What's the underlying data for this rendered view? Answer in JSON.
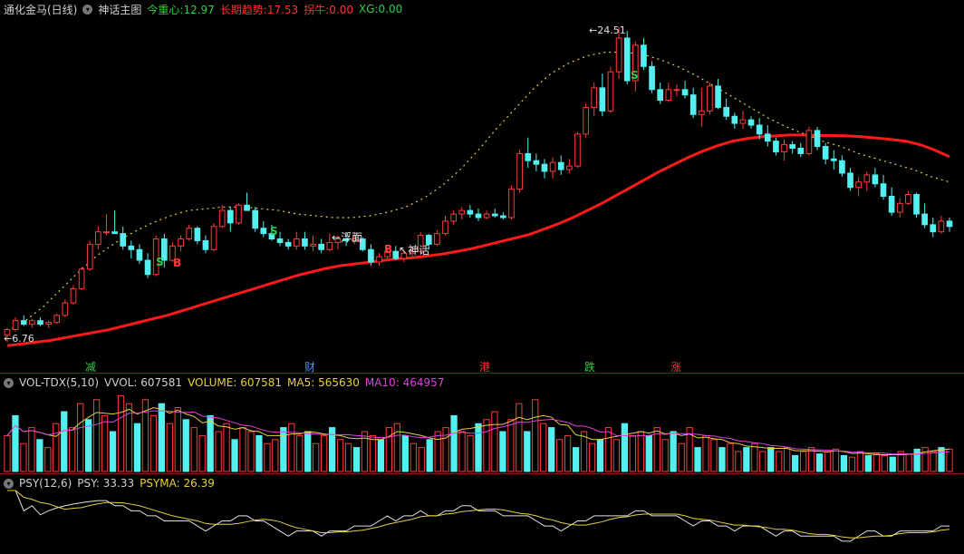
{
  "main": {
    "indicator_name": "通化金马(日线)",
    "formula_name": "神话主图",
    "legend": [
      {
        "label": "今重心:",
        "value": "12.97",
        "color": "#2ecc40"
      },
      {
        "label": "长期趋势:",
        "value": "17.53",
        "color": "#ff3030"
      },
      {
        "label": "拐牛:",
        "value": "0.00",
        "color": "#ff3030"
      },
      {
        "label": "XG:",
        "value": "0.00",
        "color": "#2ecc40"
      }
    ],
    "low_label": "6.76",
    "high_label": "24.51",
    "annotations": {
      "float_label": "浮面",
      "shenhua_label": "神话"
    },
    "signals": {
      "s1": "S",
      "b1": "B",
      "s2": "S",
      "b2": "B",
      "s3": "S"
    },
    "event_labels": [
      {
        "text": "减",
        "color": "#2ecc40"
      },
      {
        "text": "财",
        "color": "#4a90ff"
      },
      {
        "text": "港",
        "color": "#ff3030"
      },
      {
        "text": "跌",
        "color": "#2ecc40"
      },
      {
        "text": "涨",
        "color": "#ff3030"
      }
    ]
  },
  "volume": {
    "name": "VOL-TDX(5,10)",
    "legend": [
      {
        "label": "VVOL:",
        "value": "607581",
        "color": "#d0d0d0"
      },
      {
        "label": "VOLUME:",
        "value": "607581",
        "color": "#e8d040"
      },
      {
        "label": "MA5:",
        "value": "565630",
        "color": "#e8d040"
      },
      {
        "label": "MA10:",
        "value": "464957",
        "color": "#e040e0"
      }
    ]
  },
  "psy": {
    "name": "PSY(12,6)",
    "legend": [
      {
        "label": "PSY:",
        "value": "33.33",
        "color": "#d0d0d0"
      },
      {
        "label": "PSYMA:",
        "value": "26.39",
        "color": "#e8d040"
      }
    ]
  },
  "colors": {
    "up": "#ff3a3a",
    "down": "#54f0f0",
    "trend": "#ff1a1a",
    "dotted": "#e8d040",
    "ma10": "#e040e0"
  },
  "chart_data": {
    "type": "candlestick",
    "price_range": [
      6.76,
      24.51
    ],
    "candles": [
      [
        7.2,
        7.6,
        6.8,
        7.5
      ],
      [
        7.5,
        8.2,
        7.4,
        8.0
      ],
      [
        8.0,
        8.3,
        7.7,
        7.8
      ],
      [
        7.8,
        8.1,
        7.6,
        8.0
      ],
      [
        8.0,
        8.2,
        7.7,
        7.8
      ],
      [
        7.8,
        8.0,
        7.6,
        7.9
      ],
      [
        7.9,
        8.4,
        7.8,
        8.3
      ],
      [
        8.3,
        9.2,
        8.2,
        9.0
      ],
      [
        9.0,
        10.0,
        8.9,
        9.8
      ],
      [
        9.8,
        11.0,
        9.7,
        10.9
      ],
      [
        10.9,
        12.5,
        10.8,
        12.3
      ],
      [
        12.3,
        13.3,
        12.0,
        13.0
      ],
      [
        13.0,
        14.0,
        12.8,
        13.0
      ],
      [
        13.0,
        14.2,
        12.9,
        12.9
      ],
      [
        12.9,
        13.3,
        12.0,
        12.2
      ],
      [
        12.2,
        12.5,
        11.5,
        12.0
      ],
      [
        12.0,
        12.3,
        11.2,
        11.4
      ],
      [
        11.4,
        11.8,
        10.4,
        10.6
      ],
      [
        10.6,
        12.8,
        10.5,
        12.6
      ],
      [
        12.6,
        12.9,
        11.0,
        11.4
      ],
      [
        11.4,
        12.4,
        11.3,
        12.2
      ],
      [
        12.2,
        12.8,
        11.9,
        12.6
      ],
      [
        12.6,
        13.4,
        12.5,
        13.2
      ],
      [
        13.2,
        13.3,
        12.3,
        12.5
      ],
      [
        12.5,
        12.8,
        11.8,
        12.0
      ],
      [
        12.0,
        13.5,
        11.9,
        13.3
      ],
      [
        13.3,
        14.5,
        13.2,
        14.2
      ],
      [
        14.2,
        14.4,
        13.0,
        13.5
      ],
      [
        13.5,
        14.6,
        13.4,
        14.5
      ],
      [
        14.5,
        15.2,
        14.3,
        14.2
      ],
      [
        14.2,
        14.4,
        13.0,
        13.2
      ],
      [
        13.2,
        13.6,
        12.7,
        12.9
      ],
      [
        12.9,
        13.4,
        12.5,
        12.6
      ],
      [
        12.6,
        13.0,
        12.2,
        12.4
      ],
      [
        12.4,
        12.6,
        12.0,
        12.2
      ],
      [
        12.2,
        13.0,
        12.0,
        12.6
      ],
      [
        12.6,
        13.0,
        12.0,
        12.2
      ],
      [
        12.2,
        12.8,
        11.9,
        12.3
      ],
      [
        12.3,
        12.6,
        11.8,
        12.0
      ],
      [
        12.0,
        12.9,
        11.9,
        12.4
      ],
      [
        12.4,
        12.8,
        12.0,
        12.6
      ],
      [
        12.6,
        12.9,
        12.2,
        12.5
      ],
      [
        12.5,
        13.0,
        12.3,
        12.6
      ],
      [
        12.6,
        12.7,
        11.9,
        12.0
      ],
      [
        12.0,
        12.3,
        11.1,
        11.3
      ],
      [
        11.3,
        11.8,
        11.1,
        11.6
      ],
      [
        11.6,
        12.1,
        11.5,
        11.9
      ],
      [
        11.9,
        12.2,
        11.4,
        11.5
      ],
      [
        11.5,
        12.0,
        11.3,
        11.8
      ],
      [
        11.8,
        12.2,
        11.6,
        11.9
      ],
      [
        11.9,
        13.0,
        11.8,
        12.8
      ],
      [
        12.8,
        12.9,
        12.0,
        12.3
      ],
      [
        12.3,
        13.1,
        12.2,
        12.9
      ],
      [
        12.9,
        13.9,
        12.8,
        13.6
      ],
      [
        13.6,
        14.2,
        13.4,
        14.0
      ],
      [
        14.0,
        14.4,
        13.7,
        14.2
      ],
      [
        14.2,
        14.5,
        13.8,
        14.0
      ],
      [
        14.0,
        14.3,
        13.6,
        13.8
      ],
      [
        13.8,
        14.2,
        13.7,
        14.0
      ],
      [
        14.0,
        14.3,
        13.8,
        13.9
      ],
      [
        13.9,
        14.1,
        13.7,
        13.8
      ],
      [
        13.8,
        15.6,
        13.7,
        15.4
      ],
      [
        15.4,
        17.6,
        15.2,
        17.4
      ],
      [
        17.4,
        18.3,
        16.6,
        17.0
      ],
      [
        17.0,
        17.4,
        16.4,
        16.8
      ],
      [
        16.8,
        17.1,
        16.0,
        16.4
      ],
      [
        16.4,
        17.2,
        16.0,
        16.9
      ],
      [
        16.9,
        17.3,
        16.2,
        16.5
      ],
      [
        16.5,
        17.1,
        16.3,
        16.7
      ],
      [
        16.7,
        18.6,
        16.6,
        18.5
      ],
      [
        18.5,
        20.2,
        18.3,
        20.0
      ],
      [
        20.0,
        21.4,
        19.5,
        21.1
      ],
      [
        21.1,
        21.9,
        19.5,
        19.8
      ],
      [
        19.8,
        22.3,
        19.7,
        22.0
      ],
      [
        22.0,
        24.51,
        21.6,
        23.9
      ],
      [
        23.9,
        24.3,
        21.3,
        21.5
      ],
      [
        21.5,
        23.7,
        20.9,
        23.5
      ],
      [
        23.5,
        23.9,
        22.1,
        22.3
      ],
      [
        22.3,
        22.6,
        20.8,
        21.0
      ],
      [
        21.0,
        21.4,
        20.2,
        20.4
      ],
      [
        20.4,
        21.4,
        20.3,
        21.0
      ],
      [
        21.0,
        21.3,
        20.6,
        21.0
      ],
      [
        21.0,
        21.5,
        20.5,
        20.7
      ],
      [
        20.7,
        21.1,
        19.4,
        19.6
      ],
      [
        19.6,
        21.1,
        18.9,
        19.8
      ],
      [
        19.8,
        21.4,
        19.6,
        21.2
      ],
      [
        21.2,
        21.6,
        19.9,
        20.0
      ],
      [
        20.0,
        20.5,
        19.3,
        19.5
      ],
      [
        19.5,
        19.7,
        18.8,
        19.1
      ],
      [
        19.1,
        19.8,
        18.8,
        19.3
      ],
      [
        19.3,
        19.5,
        18.8,
        19.0
      ],
      [
        19.0,
        19.4,
        18.2,
        18.5
      ],
      [
        18.5,
        19.0,
        17.8,
        18.1
      ],
      [
        18.1,
        18.3,
        17.3,
        17.5
      ],
      [
        17.5,
        18.2,
        17.0,
        17.9
      ],
      [
        17.9,
        18.1,
        17.4,
        17.7
      ],
      [
        17.7,
        18.0,
        17.2,
        17.4
      ],
      [
        17.4,
        18.9,
        17.3,
        18.7
      ],
      [
        18.7,
        18.9,
        17.6,
        17.8
      ],
      [
        17.8,
        18.0,
        16.8,
        17.1
      ],
      [
        17.1,
        17.6,
        16.5,
        17.0
      ],
      [
        17.0,
        17.3,
        16.1,
        16.3
      ],
      [
        16.3,
        16.6,
        15.3,
        15.5
      ],
      [
        15.5,
        16.1,
        15.0,
        15.8
      ],
      [
        15.8,
        16.4,
        15.3,
        16.2
      ],
      [
        16.2,
        16.6,
        15.5,
        15.7
      ],
      [
        15.7,
        16.2,
        14.8,
        15.0
      ],
      [
        15.0,
        15.5,
        13.9,
        14.1
      ],
      [
        14.1,
        14.9,
        13.8,
        14.6
      ],
      [
        14.6,
        15.3,
        14.5,
        15.1
      ],
      [
        15.1,
        15.2,
        13.8,
        14.0
      ],
      [
        14.0,
        14.6,
        13.2,
        13.4
      ],
      [
        13.4,
        13.8,
        12.7,
        13.0
      ],
      [
        13.0,
        13.9,
        12.9,
        13.6
      ],
      [
        13.6,
        13.8,
        13.0,
        13.3
      ]
    ],
    "trend_series": [
      6.9,
      7.0,
      7.1,
      7.2,
      7.35,
      7.5,
      7.65,
      7.8,
      8.0,
      8.2,
      8.4,
      8.6,
      8.85,
      9.1,
      9.35,
      9.6,
      9.85,
      10.1,
      10.35,
      10.6,
      10.85,
      11.05,
      11.25,
      11.4,
      11.5,
      11.6,
      11.7,
      11.8,
      11.85,
      11.95,
      12.05,
      12.2,
      12.35,
      12.55,
      12.75,
      12.95,
      13.15,
      13.45,
      13.75,
      14.1,
      14.5,
      14.9,
      15.35,
      15.8,
      16.25,
      16.7,
      17.1,
      17.5,
      17.85,
      18.15,
      18.4,
      18.55,
      18.65,
      18.7,
      18.75,
      18.75,
      18.73,
      18.72,
      18.7,
      18.65,
      18.58,
      18.5,
      18.4,
      18.2,
      17.9,
      17.53
    ],
    "dotted_series": [
      7.4,
      8.0,
      8.8,
      9.8,
      10.8,
      11.7,
      12.4,
      13.0,
      13.5,
      13.9,
      14.2,
      14.3,
      14.4,
      14.4,
      14.3,
      14.2,
      14.0,
      13.9,
      13.8,
      13.8,
      13.9,
      14.1,
      14.4,
      14.9,
      15.6,
      16.5,
      17.6,
      18.8,
      19.9,
      21.0,
      21.9,
      22.5,
      22.9,
      23.1,
      23.1,
      23.0,
      22.7,
      22.3,
      21.8,
      21.2,
      20.6,
      20.0,
      19.4,
      18.9,
      18.5,
      18.1,
      17.8,
      17.4,
      17.1,
      16.8,
      16.5,
      16.1,
      15.8
    ],
    "volume_pct": [
      0.45,
      0.7,
      0.35,
      0.55,
      0.4,
      0.3,
      0.6,
      0.75,
      0.55,
      0.85,
      0.65,
      0.9,
      0.7,
      0.5,
      0.95,
      0.85,
      0.6,
      0.9,
      0.7,
      0.85,
      0.6,
      0.8,
      0.65,
      0.55,
      0.45,
      0.7,
      0.5,
      0.6,
      0.4,
      0.55,
      0.5,
      0.45,
      0.35,
      0.4,
      0.55,
      0.6,
      0.45,
      0.5,
      0.35,
      0.45,
      0.55,
      0.4,
      0.35,
      0.3,
      0.5,
      0.45,
      0.4,
      0.55,
      0.6,
      0.45,
      0.35,
      0.3,
      0.4,
      0.5,
      0.55,
      0.7,
      0.5,
      0.45,
      0.6,
      0.65,
      0.75,
      0.5,
      0.65,
      0.85,
      0.5,
      0.9,
      0.6,
      0.55,
      0.4,
      0.45,
      0.3,
      0.5,
      0.35,
      0.4,
      0.55,
      0.4,
      0.6,
      0.45,
      0.5,
      0.45,
      0.55,
      0.4,
      0.5,
      0.35,
      0.55,
      0.3,
      0.45,
      0.4,
      0.3,
      0.35,
      0.25,
      0.3,
      0.35,
      0.25,
      0.3,
      0.25,
      0.3,
      0.2,
      0.25,
      0.3,
      0.22,
      0.25,
      0.28,
      0.2,
      0.18,
      0.25,
      0.2,
      0.22,
      0.2,
      0.18,
      0.25,
      0.22,
      0.28,
      0.3,
      0.25,
      0.3,
      0.28
    ]
  }
}
